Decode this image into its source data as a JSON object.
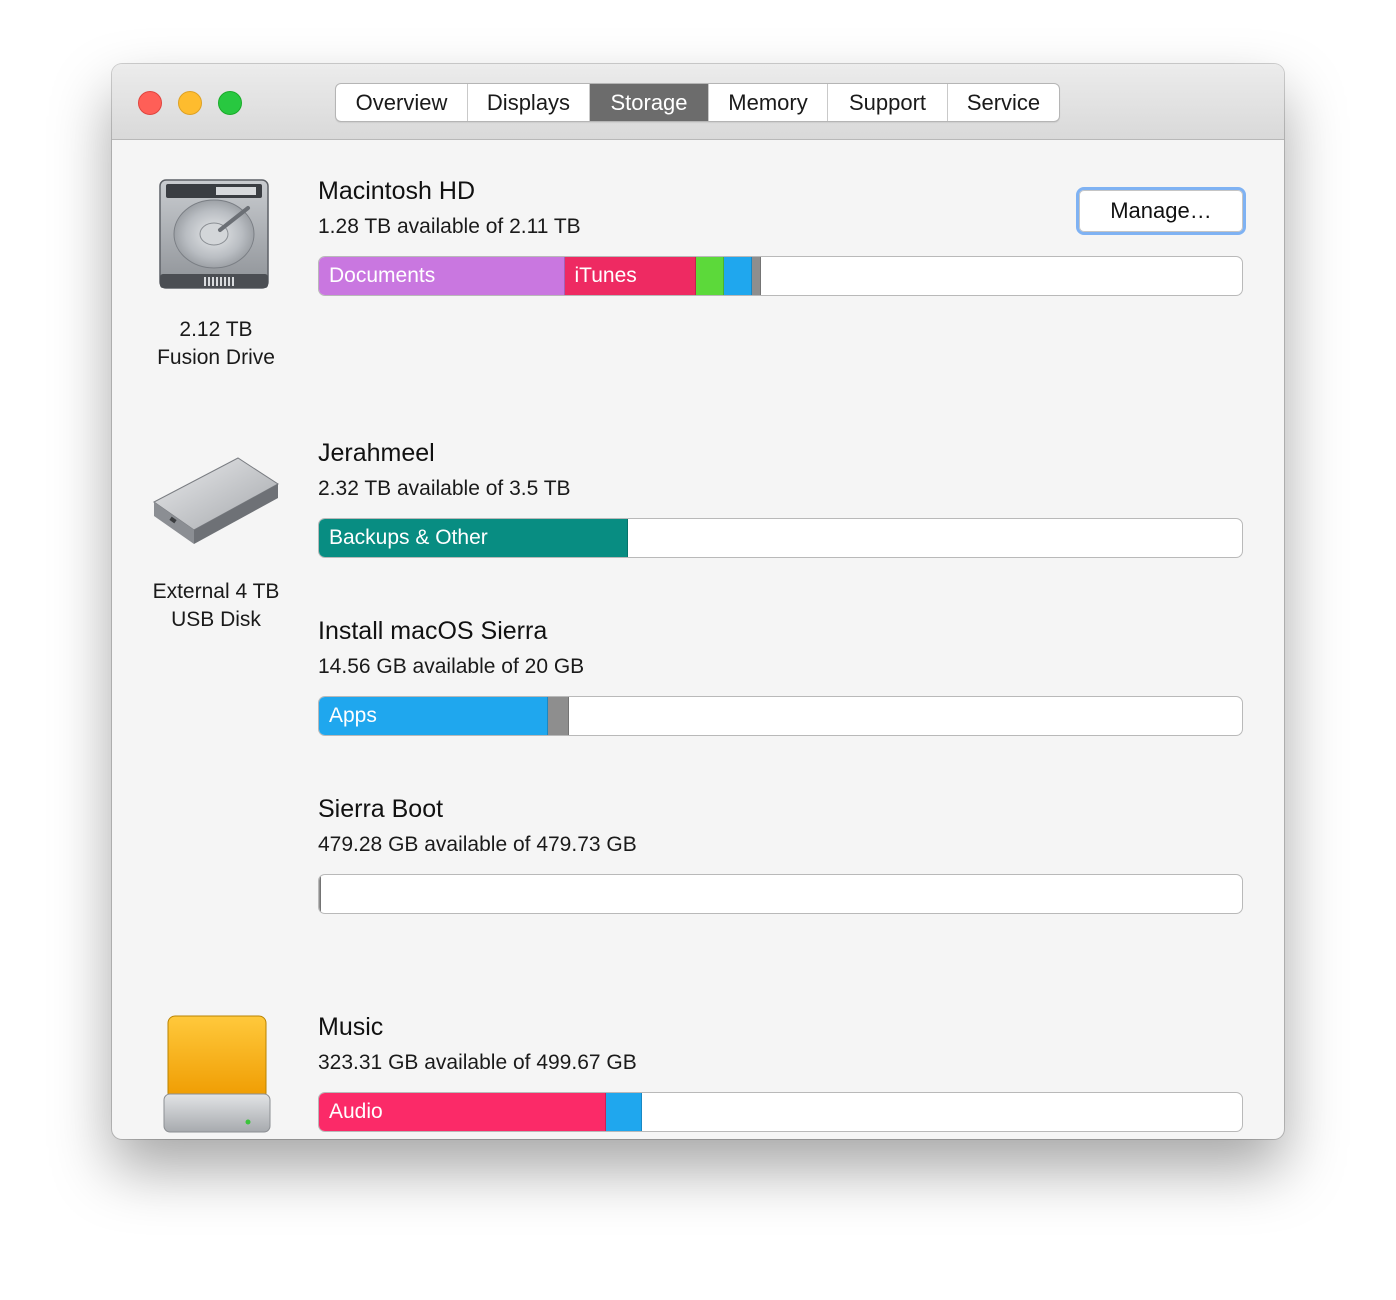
{
  "tabs": [
    {
      "label": "Overview",
      "active": false
    },
    {
      "label": "Displays",
      "active": false
    },
    {
      "label": "Storage",
      "active": true
    },
    {
      "label": "Memory",
      "active": false
    },
    {
      "label": "Support",
      "active": false
    },
    {
      "label": "Service",
      "active": false
    }
  ],
  "manage_label": "Manage…",
  "disks": [
    {
      "caption_line1": "2.12 TB",
      "caption_line2": "Fusion Drive",
      "icon": "internal-hard-drive-icon"
    },
    {
      "caption_line1": "External 4 TB",
      "caption_line2": "USB Disk",
      "icon": "external-usb-disk-icon"
    },
    {
      "icon": "removable-volume-icon"
    }
  ],
  "volumes": [
    {
      "name": "Macintosh HD",
      "available": "1.28 TB available of 2.11 TB",
      "usage": [
        {
          "label": "Documents",
          "fraction": 0.266,
          "color": "#c977e0"
        },
        {
          "label": "iTunes",
          "fraction": 0.142,
          "color": "#ee2a62"
        },
        {
          "label": "",
          "fraction": 0.031,
          "color": "#5cd93a"
        },
        {
          "label": "",
          "fraction": 0.03,
          "color": "#1fa7ee"
        },
        {
          "label": "",
          "fraction": 0.01,
          "color": "#8e8e8e"
        }
      ]
    },
    {
      "name": "Jerahmeel",
      "available": "2.32 TB available of 3.5 TB",
      "usage": [
        {
          "label": "Backups & Other",
          "fraction": 0.335,
          "color": "#088d82"
        }
      ]
    },
    {
      "name": "Install macOS Sierra",
      "available": "14.56 GB available of 20 GB",
      "usage": [
        {
          "label": "Apps",
          "fraction": 0.248,
          "color": "#1fa7ee"
        },
        {
          "label": "",
          "fraction": 0.023,
          "color": "#8e8e8e"
        }
      ]
    },
    {
      "name": "Sierra Boot",
      "available": "479.28 GB available of 479.73 GB",
      "usage": [
        {
          "label": "",
          "fraction": 0.002,
          "color": "#8e8e8e"
        }
      ]
    },
    {
      "name": "Music",
      "available": "323.31 GB available of 499.67 GB",
      "usage": [
        {
          "label": "Audio",
          "fraction": 0.311,
          "color": "#fb2a68"
        },
        {
          "label": "",
          "fraction": 0.039,
          "color": "#1fa7ee"
        }
      ]
    }
  ]
}
